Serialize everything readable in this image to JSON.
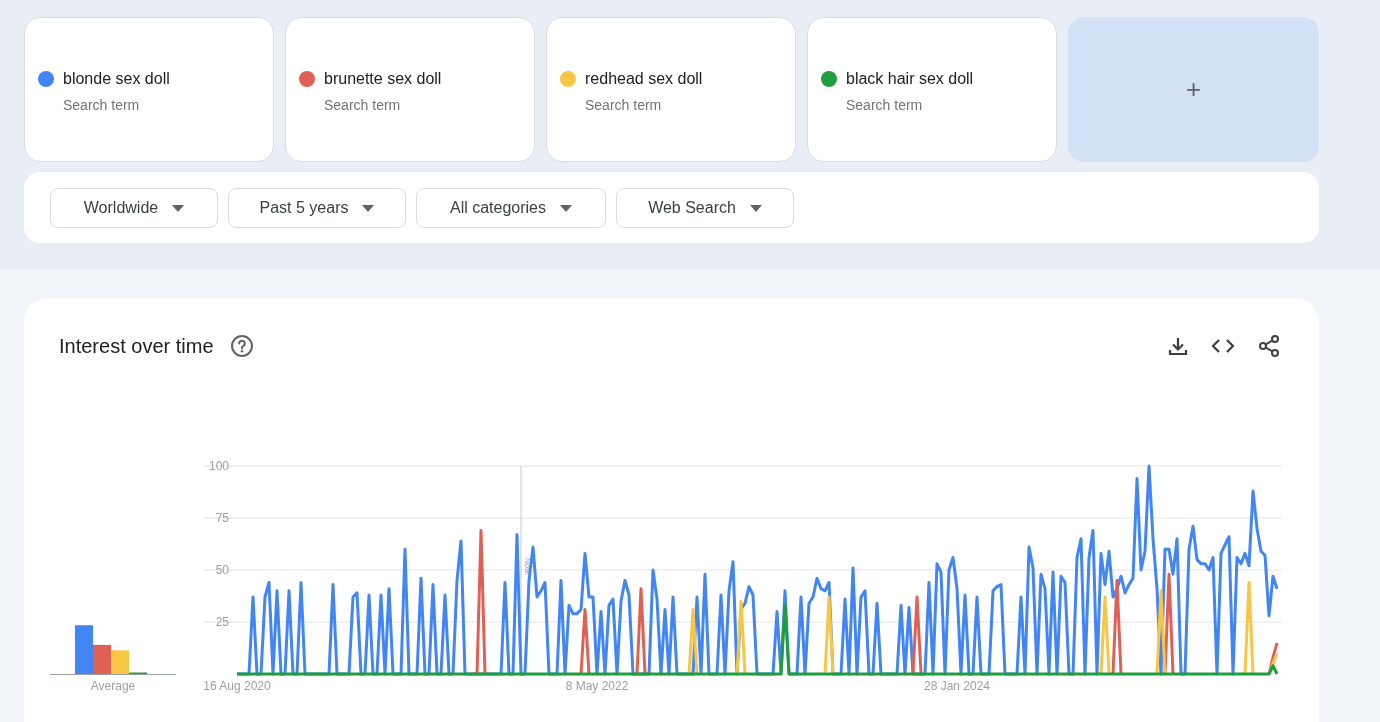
{
  "search_terms": [
    {
      "subtitle": "Search term"
    },
    {
      "subtitle": "Search term"
    },
    {
      "subtitle": "Search term"
    },
    {
      "subtitle": "Search term"
    }
  ],
  "add_button": {
    "label": "+"
  },
  "filters": [
    {
      "label": "Worldwide"
    },
    {
      "label": "Past 5 years"
    },
    {
      "label": "All categories"
    },
    {
      "label": "Web Search"
    }
  ],
  "interest_over_time": {
    "title": "Interest over time",
    "average_label": "Average",
    "note_label": "Note",
    "chart_data": {
      "type": "line",
      "grid": true,
      "ylim": [
        0,
        100
      ],
      "yticks": [
        25,
        50,
        75,
        100
      ],
      "categories": [
        "16 Aug 2020",
        null,
        null,
        null,
        null,
        null,
        null,
        null,
        null,
        null,
        null,
        null,
        null,
        null,
        null,
        null,
        null,
        null,
        null,
        null,
        null,
        null,
        null,
        null,
        null,
        null,
        null,
        null,
        null,
        null,
        null,
        null,
        null,
        null,
        null,
        null,
        null,
        null,
        null,
        null,
        null,
        null,
        null,
        null,
        null,
        null,
        null,
        null,
        null,
        null,
        null,
        null,
        null,
        null,
        null,
        null,
        null,
        null,
        null,
        null,
        null,
        null,
        null,
        null,
        null,
        null,
        null,
        null,
        null,
        null,
        null,
        null,
        null,
        null,
        null,
        null,
        null,
        null,
        null,
        null,
        null,
        null,
        null,
        null,
        null,
        null,
        null,
        null,
        null,
        null,
        "8 May 2022",
        null,
        null,
        null,
        null,
        null,
        null,
        null,
        null,
        null,
        null,
        null,
        null,
        null,
        null,
        null,
        null,
        null,
        null,
        null,
        null,
        null,
        null,
        null,
        null,
        null,
        null,
        null,
        null,
        null,
        null,
        null,
        null,
        null,
        null,
        null,
        null,
        null,
        null,
        null,
        null,
        null,
        null,
        null,
        null,
        null,
        null,
        null,
        null,
        null,
        null,
        null,
        null,
        null,
        null,
        null,
        null,
        null,
        null,
        null,
        null,
        null,
        null,
        null,
        null,
        null,
        null,
        null,
        null,
        null,
        null,
        null,
        null,
        null,
        null,
        null,
        null,
        null,
        null,
        null,
        null,
        null,
        null,
        null,
        null,
        null,
        null,
        null,
        null,
        null,
        "28 Jan 2024",
        null,
        null,
        null,
        null,
        null,
        null,
        null,
        null,
        null,
        null,
        null,
        null,
        null,
        null,
        null,
        null,
        null,
        null,
        null,
        null,
        null,
        null,
        null,
        null,
        null,
        null,
        null,
        null,
        null,
        null,
        null,
        null,
        null,
        null,
        null,
        null,
        null,
        null,
        null,
        null,
        null,
        null,
        null,
        null,
        null,
        null,
        null,
        null,
        null,
        null,
        null,
        null,
        null,
        null,
        null,
        null,
        null,
        null,
        null,
        null,
        null,
        null,
        null,
        null,
        null,
        null,
        null,
        null,
        null,
        null,
        null,
        null,
        null,
        null,
        null,
        null,
        null,
        null,
        null,
        null
      ],
      "series": [
        {
          "name": "blonde sex doll",
          "color": "#4285f4",
          "values": [
            0,
            0,
            0,
            0,
            37,
            0,
            0,
            37,
            44,
            0,
            40,
            0,
            0,
            40,
            0,
            0,
            44,
            0,
            0,
            0,
            0,
            0,
            0,
            0,
            43,
            0,
            0,
            0,
            0,
            37,
            39,
            0,
            0,
            38,
            0,
            0,
            38,
            0,
            41,
            0,
            0,
            0,
            60,
            0,
            0,
            0,
            46,
            0,
            0,
            43,
            0,
            0,
            38,
            0,
            0,
            45,
            64,
            0,
            0,
            0,
            0,
            0,
            0,
            0,
            0,
            0,
            0,
            44,
            0,
            0,
            67,
            0,
            0,
            45,
            61,
            37,
            40,
            44,
            0,
            0,
            0,
            45,
            0,
            33,
            29,
            29,
            31,
            58,
            37,
            37,
            0,
            30,
            0,
            33,
            36,
            0,
            35,
            45,
            38,
            0,
            0,
            0,
            0,
            0,
            50,
            36,
            0,
            31,
            0,
            37,
            0,
            0,
            0,
            0,
            0,
            37,
            0,
            48,
            0,
            0,
            0,
            38,
            0,
            40,
            54,
            0,
            31,
            34,
            42,
            38,
            0,
            0,
            0,
            0,
            0,
            30,
            0,
            40,
            0,
            0,
            0,
            37,
            0,
            34,
            37,
            46,
            41,
            40,
            44,
            0,
            0,
            0,
            36,
            0,
            51,
            0,
            37,
            40,
            0,
            0,
            34,
            0,
            0,
            0,
            0,
            0,
            33,
            0,
            32,
            0,
            0,
            0,
            0,
            44,
            0,
            53,
            49,
            0,
            50,
            56,
            41,
            0,
            38,
            0,
            0,
            37,
            0,
            0,
            0,
            40,
            42,
            43,
            0,
            0,
            0,
            0,
            37,
            0,
            61,
            51,
            0,
            48,
            41,
            0,
            49,
            0,
            47,
            44,
            0,
            0,
            56,
            65,
            0,
            56,
            69,
            0,
            58,
            43,
            59,
            37,
            41,
            47,
            39,
            43,
            46,
            94,
            50,
            59,
            100,
            65,
            41,
            0,
            60,
            60,
            48,
            65,
            0,
            0,
            60,
            71,
            55,
            53,
            53,
            50,
            56,
            0,
            58,
            62,
            66,
            0,
            56,
            53,
            58,
            52,
            88,
            70,
            59,
            57,
            28,
            47,
            41
          ]
        },
        {
          "name": "brunette sex doll",
          "color": "#e06055",
          "values": [
            null,
            null,
            null,
            null,
            null,
            null,
            null,
            null,
            null,
            null,
            null,
            null,
            null,
            null,
            null,
            null,
            null,
            null,
            null,
            null,
            null,
            null,
            null,
            null,
            null,
            null,
            null,
            null,
            null,
            null,
            null,
            null,
            null,
            null,
            null,
            null,
            null,
            null,
            null,
            null,
            null,
            null,
            null,
            null,
            null,
            null,
            null,
            null,
            null,
            null,
            null,
            null,
            null,
            null,
            null,
            null,
            null,
            null,
            null,
            null,
            0,
            69,
            0,
            null,
            null,
            null,
            null,
            null,
            null,
            null,
            null,
            null,
            null,
            null,
            null,
            null,
            null,
            null,
            null,
            null,
            null,
            null,
            null,
            null,
            null,
            null,
            0,
            31,
            0,
            null,
            null,
            null,
            null,
            null,
            null,
            null,
            null,
            null,
            null,
            null,
            0,
            41,
            0,
            null,
            null,
            null,
            null,
            null,
            null,
            null,
            null,
            null,
            null,
            null,
            null,
            null,
            null,
            null,
            null,
            null,
            null,
            null,
            null,
            null,
            null,
            null,
            null,
            null,
            null,
            null,
            null,
            null,
            null,
            null,
            null,
            null,
            null,
            null,
            null,
            null,
            null,
            null,
            null,
            null,
            null,
            null,
            null,
            null,
            null,
            null,
            null,
            null,
            null,
            null,
            null,
            null,
            null,
            null,
            null,
            null,
            null,
            null,
            null,
            null,
            null,
            null,
            null,
            null,
            null,
            0,
            37,
            0,
            null,
            null,
            null,
            null,
            null,
            null,
            null,
            null,
            null,
            null,
            null,
            null,
            null,
            null,
            null,
            null,
            null,
            null,
            null,
            null,
            null,
            null,
            null,
            null,
            null,
            null,
            null,
            null,
            null,
            null,
            null,
            null,
            null,
            null,
            null,
            null,
            null,
            null,
            null,
            null,
            null,
            null,
            null,
            null,
            null,
            null,
            null,
            0,
            45,
            0,
            null,
            null,
            null,
            null,
            null,
            null,
            null,
            null,
            null,
            null,
            0,
            48,
            0,
            null,
            null,
            null,
            null,
            null,
            null,
            null,
            null,
            null,
            null,
            null,
            null,
            null,
            null,
            null,
            null,
            null,
            null,
            null,
            null,
            null,
            null,
            null,
            0,
            8,
            15
          ]
        },
        {
          "name": "redhead sex doll",
          "color": "#f6c644",
          "values": [
            null,
            null,
            null,
            null,
            null,
            null,
            null,
            null,
            null,
            null,
            null,
            null,
            null,
            null,
            null,
            null,
            null,
            null,
            null,
            null,
            null,
            null,
            null,
            null,
            null,
            null,
            null,
            null,
            null,
            null,
            null,
            null,
            null,
            null,
            null,
            null,
            null,
            null,
            null,
            null,
            null,
            null,
            null,
            null,
            null,
            null,
            null,
            null,
            null,
            null,
            null,
            null,
            null,
            null,
            null,
            null,
            null,
            null,
            null,
            null,
            null,
            null,
            null,
            null,
            null,
            null,
            null,
            null,
            null,
            null,
            null,
            null,
            null,
            null,
            null,
            null,
            null,
            null,
            null,
            null,
            null,
            null,
            null,
            null,
            null,
            null,
            null,
            null,
            null,
            null,
            null,
            null,
            null,
            null,
            null,
            null,
            null,
            null,
            null,
            null,
            null,
            null,
            null,
            null,
            null,
            null,
            null,
            null,
            null,
            null,
            null,
            null,
            null,
            0,
            31,
            0,
            null,
            null,
            null,
            null,
            null,
            null,
            null,
            null,
            null,
            0,
            35,
            0,
            null,
            null,
            null,
            null,
            null,
            null,
            null,
            null,
            null,
            null,
            null,
            null,
            null,
            null,
            null,
            null,
            null,
            null,
            null,
            0,
            37,
            0,
            null,
            null,
            null,
            null,
            null,
            null,
            null,
            null,
            null,
            null,
            null,
            null,
            null,
            null,
            null,
            null,
            null,
            null,
            null,
            null,
            null,
            null,
            null,
            null,
            null,
            null,
            null,
            null,
            null,
            null,
            null,
            null,
            null,
            null,
            null,
            null,
            null,
            null,
            null,
            null,
            null,
            null,
            null,
            null,
            null,
            null,
            null,
            null,
            null,
            null,
            null,
            null,
            null,
            null,
            null,
            null,
            null,
            null,
            null,
            null,
            null,
            null,
            null,
            null,
            null,
            null,
            0,
            37,
            0,
            null,
            null,
            null,
            null,
            null,
            null,
            null,
            null,
            null,
            null,
            null,
            0,
            40,
            0,
            null,
            null,
            null,
            null,
            null,
            null,
            null,
            null,
            null,
            null,
            null,
            null,
            null,
            null,
            null,
            null,
            null,
            null,
            null,
            0,
            44,
            0,
            null,
            null,
            null,
            0,
            5,
            10
          ]
        },
        {
          "name": "black hair sex doll",
          "color": "#1e9e3d",
          "values": [
            0,
            0,
            0,
            0,
            0,
            0,
            0,
            0,
            0,
            0,
            0,
            0,
            0,
            0,
            0,
            0,
            0,
            0,
            0,
            0,
            0,
            0,
            0,
            0,
            0,
            0,
            0,
            0,
            0,
            0,
            0,
            0,
            0,
            0,
            0,
            0,
            0,
            0,
            0,
            0,
            0,
            0,
            0,
            0,
            0,
            0,
            0,
            0,
            0,
            0,
            0,
            0,
            0,
            0,
            0,
            0,
            0,
            0,
            0,
            0,
            0,
            0,
            0,
            0,
            0,
            0,
            0,
            0,
            0,
            0,
            0,
            0,
            0,
            0,
            0,
            0,
            0,
            0,
            0,
            0,
            0,
            0,
            0,
            0,
            0,
            0,
            0,
            0,
            0,
            0,
            0,
            0,
            0,
            0,
            0,
            0,
            0,
            0,
            0,
            0,
            0,
            0,
            0,
            0,
            0,
            0,
            0,
            0,
            0,
            0,
            0,
            0,
            0,
            0,
            0,
            0,
            0,
            0,
            0,
            0,
            0,
            0,
            0,
            0,
            0,
            0,
            0,
            0,
            0,
            0,
            0,
            0,
            0,
            0,
            0,
            0,
            0,
            33,
            0,
            0,
            0,
            0,
            0,
            0,
            0,
            0,
            0,
            0,
            0,
            0,
            0,
            0,
            0,
            0,
            0,
            0,
            0,
            0,
            0,
            0,
            0,
            0,
            0,
            0,
            0,
            0,
            0,
            0,
            0,
            0,
            0,
            0,
            0,
            0,
            0,
            0,
            0,
            0,
            0,
            0,
            0,
            0,
            0,
            0,
            0,
            0,
            0,
            0,
            0,
            0,
            0,
            0,
            0,
            0,
            0,
            0,
            0,
            0,
            0,
            0,
            0,
            0,
            0,
            0,
            0,
            0,
            0,
            0,
            0,
            0,
            0,
            0,
            0,
            0,
            0,
            0,
            0,
            0,
            0,
            0,
            0,
            0,
            0,
            0,
            0,
            0,
            0,
            0,
            0,
            0,
            0,
            0,
            0,
            0,
            0,
            0,
            0,
            0,
            0,
            0,
            0,
            0,
            0,
            0,
            0,
            0,
            0,
            0,
            0,
            0,
            0,
            0,
            0,
            0,
            0,
            0,
            0,
            0,
            0,
            4,
            0
          ]
        }
      ]
    }
  }
}
